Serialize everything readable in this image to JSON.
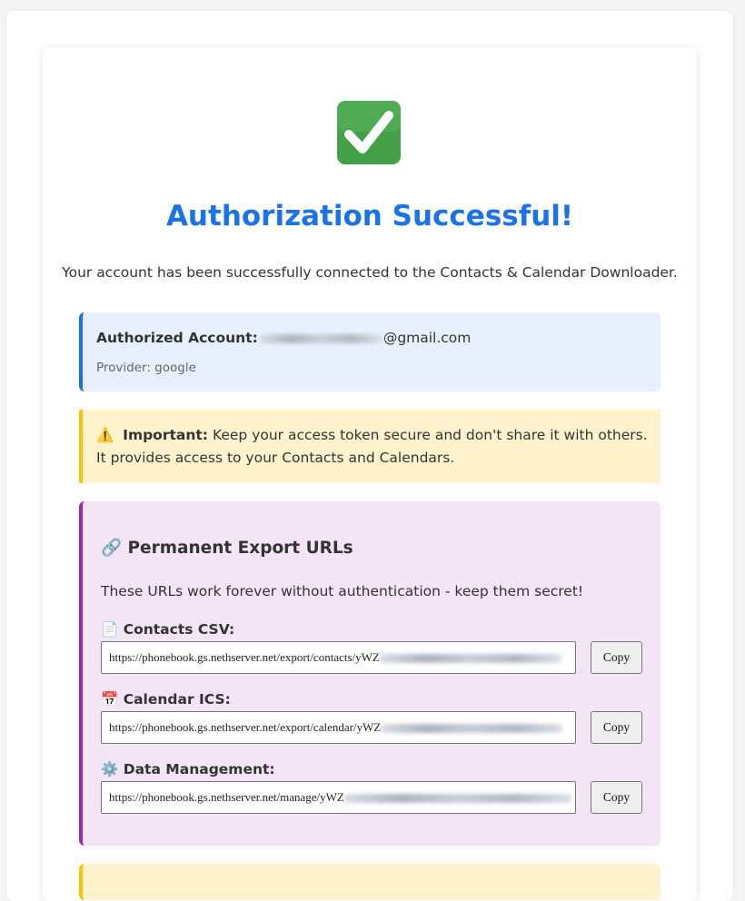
{
  "header": {
    "icon": "check-mark-icon",
    "title": "Authorization Successful!",
    "subtitle": "Your account has been successfully connected to the Contacts & Calendar Downloader."
  },
  "account": {
    "label": "Authorized Account:",
    "email_visible": "@gmail.com",
    "provider_text": "Provider: google"
  },
  "warning": {
    "icon": "warning-icon",
    "emphasis": "Important:",
    "text": "Keep your access token secure and don't share it with others. It provides access to your Contacts and Calendars."
  },
  "export_urls": {
    "title_icon": "link-icon",
    "title": "Permanent Export URLs",
    "description": "These URLs work forever without authentication - keep them secret!",
    "items": [
      {
        "icon": "document-icon",
        "label": "Contacts CSV:",
        "url_visible": "https://phonebook.gs.nethserver.net/export/contacts/yWZ",
        "button": "Copy"
      },
      {
        "icon": "calendar-icon",
        "label": "Calendar ICS:",
        "url_visible": "https://phonebook.gs.nethserver.net/export/calendar/yWZ",
        "button": "Copy"
      },
      {
        "icon": "gear-icon",
        "label": "Data Management:",
        "url_visible": "https://phonebook.gs.nethserver.net/manage/yWZ",
        "button": "Copy"
      }
    ]
  },
  "colors": {
    "accent": "#1a73e8",
    "account_bg": "#e8f0fe",
    "warning_bg": "#fff3cd",
    "warning_border": "#ffc107",
    "urls_bg": "#f3e5f5",
    "urls_border": "#9c27b0",
    "success_green": "#43a047"
  }
}
